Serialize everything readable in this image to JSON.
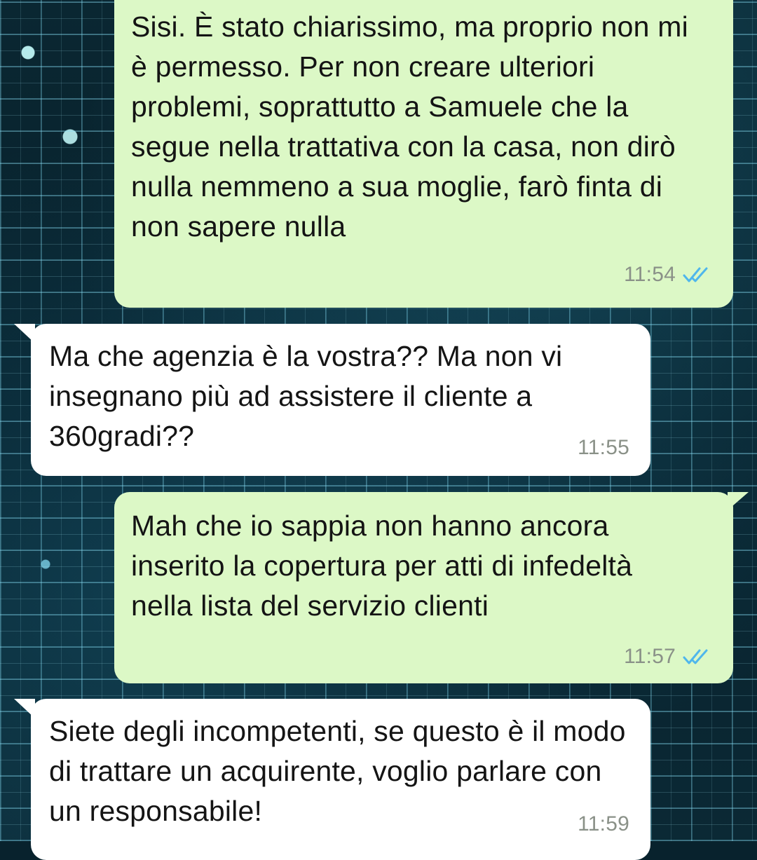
{
  "messages": [
    {
      "direction": "outgoing",
      "text": "Sisi. È stato chiarissimo, ma proprio non mi è permesso. Per non creare ulteriori problemi, soprattutto a Samuele che la segue nella trattativa con la casa, non dirò nulla nemmeno a sua moglie, farò finta di non sapere nulla",
      "time": "11:54",
      "status": "read-double-check-icon"
    },
    {
      "direction": "incoming",
      "text": "Ma che agenzia è la vostra?? Ma non vi insegnano più ad assistere il cliente a 360gradi??",
      "time": "11:55"
    },
    {
      "direction": "outgoing",
      "text": "Mah che io sappia non hanno ancora inserito la copertura per atti di infedeltà nella lista del servizio clienti",
      "time": "11:57",
      "status": "read-double-check-icon"
    },
    {
      "direction": "incoming",
      "text": "Siete degli incompetenti, se questo è il modo di trattare un acquirente, voglio parlare con un responsabile!",
      "time": "11:59"
    }
  ],
  "colors": {
    "outgoing_bubble": "#dcf8c6",
    "incoming_bubble": "#ffffff",
    "timestamp": "#8a9188",
    "read_ticks": "#4fb6ec"
  }
}
